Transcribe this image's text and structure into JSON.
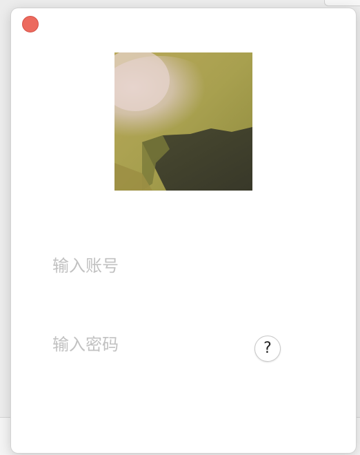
{
  "window": {
    "close_icon": "close-icon",
    "close_color": "#ec6a5e"
  },
  "avatar": {
    "description_icon": "avatar-image"
  },
  "login": {
    "account_placeholder": "输入账号",
    "account_value": "",
    "password_placeholder": "输入密码",
    "password_value": "",
    "help_label": "?"
  }
}
